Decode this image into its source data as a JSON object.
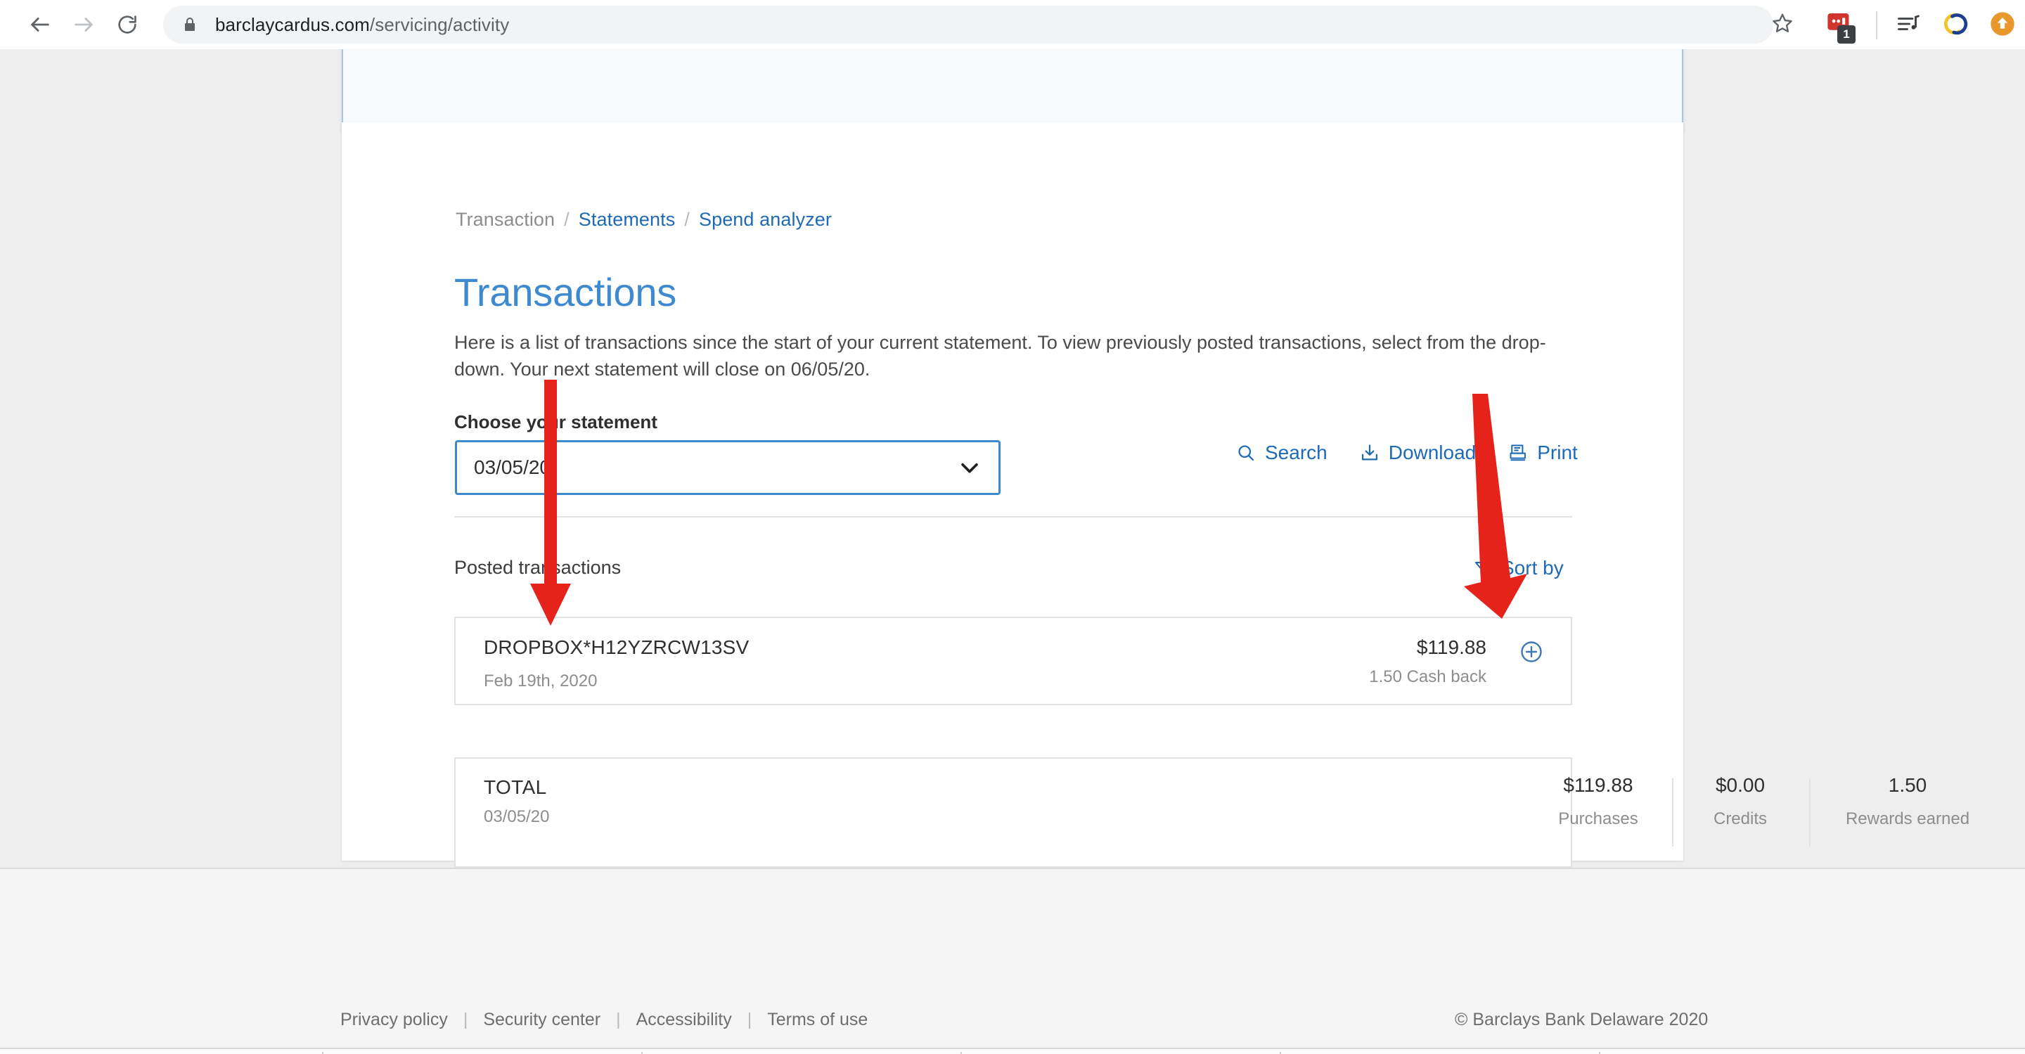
{
  "browser": {
    "back_icon": "back-arrow-icon",
    "forward_icon": "forward-arrow-icon",
    "reload_icon": "reload-icon",
    "lock_icon": "lock-icon",
    "url_host": "barclaycardus.com",
    "url_path": "/servicing/activity",
    "star_icon": "bookmark-star-icon",
    "extensions": [
      {
        "name": "annotation-extension-icon",
        "badge": "1",
        "color": "#d0342c"
      },
      {
        "name": "playlist-music-icon",
        "color": "#3c4043"
      },
      {
        "name": "grammar-check-icon",
        "color": "#f3c32c"
      },
      {
        "name": "profile-upload-icon",
        "color": "#e8972a"
      }
    ]
  },
  "breadcrumb": {
    "items": [
      {
        "label": "Transaction",
        "link": false
      },
      {
        "label": "Statements",
        "link": true
      },
      {
        "label": "Spend analyzer",
        "link": true
      }
    ],
    "separator": "/"
  },
  "page": {
    "title": "Transactions",
    "description": "Here is a list of transactions since the start of your current statement. To view previously posted transactions, select from the drop-down. Your next statement will close on 06/05/20."
  },
  "statement_selector": {
    "label": "Choose your statement",
    "value": "03/05/20",
    "caret_icon": "chevron-down-icon",
    "options": [
      "03/05/20"
    ]
  },
  "actions": [
    {
      "label": "Search",
      "icon": "search-icon"
    },
    {
      "label": "Download",
      "icon": "download-icon"
    },
    {
      "label": "Print",
      "icon": "print-icon"
    }
  ],
  "list_header": {
    "posted_label": "Posted transactions",
    "sort_label": "Sort by",
    "sort_icon": "filter-funnel-icon"
  },
  "transactions": [
    {
      "name": "DROPBOX*H12YZRCW13SV",
      "date": "Feb 19th, 2020",
      "amount": "$119.88",
      "cash_back": "1.50 Cash back",
      "expand_icon": "plus-circle-icon"
    }
  ],
  "totals": {
    "label": "TOTAL",
    "date": "03/05/20",
    "columns": [
      {
        "value": "$119.88",
        "label": "Purchases"
      },
      {
        "value": "$0.00",
        "label": "Credits"
      },
      {
        "value": "1.50",
        "label": "Rewards earned"
      }
    ]
  },
  "footer": {
    "links": [
      "Privacy policy",
      "Security center",
      "Accessibility",
      "Terms of use"
    ],
    "separator": "|",
    "copyright": "© Barclays Bank Delaware 2020"
  },
  "annotations": {
    "arrow_color": "#e5231b",
    "arrows": [
      {
        "name": "arrow-to-statement-dropdown"
      },
      {
        "name": "arrow-to-sort-by"
      }
    ]
  },
  "colors": {
    "brand_blue": "#3d8ad1",
    "link_blue": "#1f6ab5",
    "page_bg": "#eeeeee",
    "card_bg": "#ffffff",
    "footer_bg": "#f5f5f5",
    "muted_text": "#8d8d8d"
  }
}
